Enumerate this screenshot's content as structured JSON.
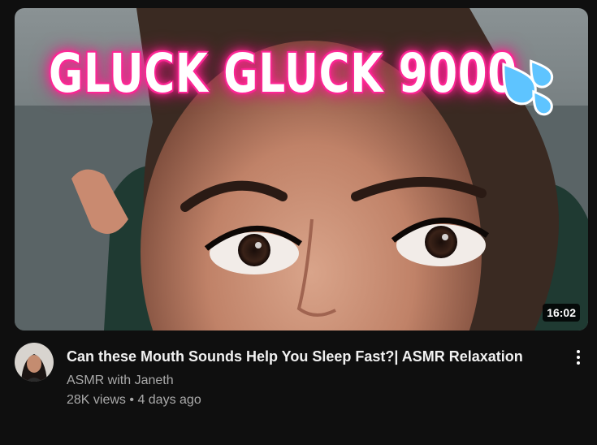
{
  "thumbnail": {
    "overlay_text": "GLUCK GLUCK 9000",
    "overlay_emoji": "sweat-droplets-icon",
    "duration": "16:02",
    "accent_color": "#ff2d9a"
  },
  "video": {
    "title": "Can these Mouth Sounds Help You Sleep Fast?| ASMR Relaxation",
    "channel": "ASMR with Janeth",
    "views": "28K views",
    "separator": "•",
    "age": "4 days ago"
  },
  "menu": {
    "icon": "more-vert-icon"
  }
}
